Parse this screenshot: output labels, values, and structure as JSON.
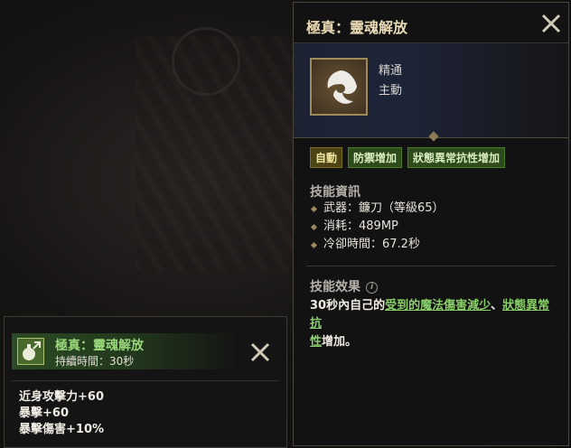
{
  "skill_panel": {
    "title": "極真：靈魂解放",
    "meta_line1": "精通",
    "meta_line2": "主動",
    "icon": "soul-release-icon",
    "close_icon": "close-icon",
    "tags": [
      "自動",
      "防禦增加",
      "狀態異常抗性增加"
    ],
    "info_header": "技能資訊",
    "info_items": [
      "武器：鐮刀（等級65）",
      "消耗：489MP",
      "冷卻時間：67.2秒"
    ],
    "effect_header": "技能效果",
    "effect_info_icon": "i",
    "effect_parts": {
      "p1": "30秒內自己的",
      "h1": "受到的魔法傷害減少",
      "p2": "、",
      "h2a": "狀態異常抗",
      "h2b": "性",
      "p3": "增加。"
    }
  },
  "buff_panel": {
    "name": "極真：靈魂解放",
    "duration": "持續時間：30秒",
    "icon": "potion-buff-icon",
    "close_icon": "close-icon",
    "stats": [
      "近身攻擊力+60",
      "暴擊+60",
      "暴擊傷害+10%"
    ]
  },
  "colors": {
    "highlight_green": "#8ad06a",
    "title_gold": "#e8d9b4",
    "buff_name_green": "#9ad87a"
  }
}
